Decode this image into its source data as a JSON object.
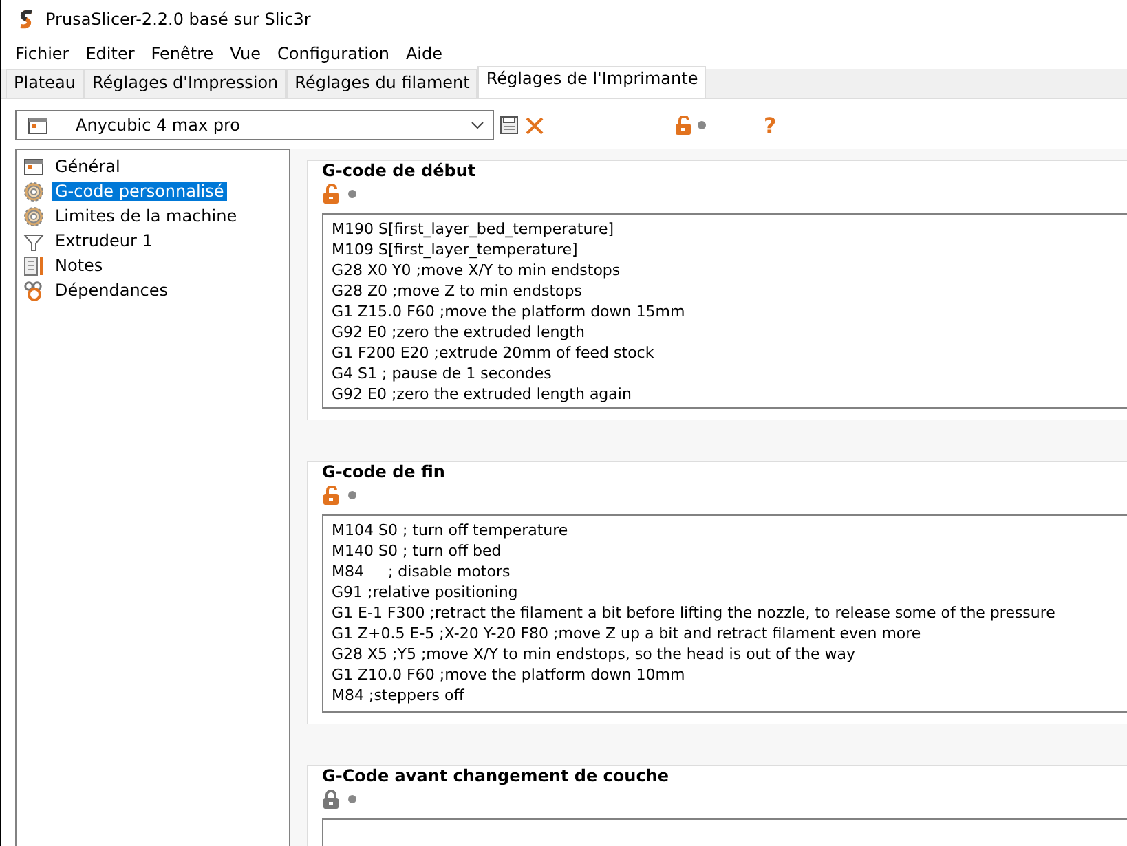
{
  "window": {
    "title": "PrusaSlicer-2.2.0 basé sur Slic3r"
  },
  "menu": [
    "Fichier",
    "Editer",
    "Fenêtre",
    "Vue",
    "Configuration",
    "Aide"
  ],
  "tabs": [
    {
      "label": "Plateau",
      "selected": false
    },
    {
      "label": "Réglages d'Impression",
      "selected": false
    },
    {
      "label": "Réglages du filament",
      "selected": false
    },
    {
      "label": "Réglages de l'Imprimante",
      "selected": true
    }
  ],
  "preset": {
    "value": "Anycubic 4 max pro"
  },
  "toolbar": {
    "help": "?"
  },
  "sidebar": {
    "items": [
      {
        "label": "Général",
        "selected": false
      },
      {
        "label": "G-code personnalisé",
        "selected": true
      },
      {
        "label": "Limites de la machine",
        "selected": false
      },
      {
        "label": "Extrudeur 1",
        "selected": false
      },
      {
        "label": "Notes",
        "selected": false
      },
      {
        "label": "Dépendances",
        "selected": false
      }
    ]
  },
  "sections": [
    {
      "title": "G-code de début",
      "locked": false,
      "lines": [
        "M190 S[first_layer_bed_temperature]",
        "M109 S[first_layer_temperature]",
        "G28 X0 Y0 ;move X/Y to min endstops",
        "G28 Z0 ;move Z to min endstops",
        "G1 Z15.0 F60 ;move the platform down 15mm",
        "G92 E0 ;zero the extruded length",
        "G1 F200 E20 ;extrude 20mm of feed stock",
        "G4 S1 ; pause de 1 secondes",
        "G92 E0 ;zero the extruded length again"
      ]
    },
    {
      "title": "G-code de fin",
      "locked": false,
      "lines": [
        "M104 S0 ; turn off temperature",
        "M140 S0 ; turn off bed",
        "M84     ; disable motors",
        "G91 ;relative positioning",
        "G1 E-1 F300 ;retract the filament a bit before lifting the nozzle, to release some of the pressure",
        "G1 Z+0.5 E-5 ;X-20 Y-20 F80 ;move Z up a bit and retract filament even more",
        "G28 X5 ;Y5 ;move X/Y to min endstops, so the head is out of the way",
        "G1 Z10.0 F60 ;move the platform down 10mm",
        "M84 ;steppers off"
      ]
    },
    {
      "title": "G-Code avant changement de couche",
      "locked": true
    }
  ]
}
